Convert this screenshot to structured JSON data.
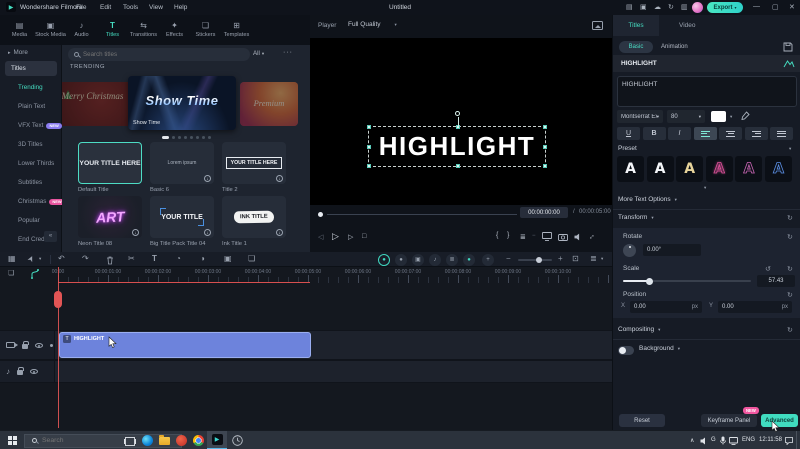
{
  "icons": {
    "chevron_down": "▾",
    "chevron_right": "▸",
    "collapse": "«",
    "more": "···",
    "media": "▤",
    "stock_media": "▣",
    "audio": "♪",
    "titles": "T",
    "transitions": "⇆",
    "effects": "✦",
    "stickers": "❏",
    "templates": "⊞",
    "layout": "▤",
    "gallery": "▣",
    "cloud": "☁",
    "sync": "↻",
    "store": "▥",
    "minimize": "—",
    "maximize": "▢",
    "close": "✕",
    "logo_play": "▶",
    "undo": "↶",
    "redo": "↷",
    "split": "✂",
    "text_tool": "T",
    "speed": "◔",
    "chroma": "◑",
    "crop": "▣",
    "group": "❏",
    "snap": "▦",
    "pointer": "➤",
    "prev_frame": "◁",
    "play": "▷",
    "next_frame": "▷",
    "stop": "□",
    "mark_in": "{",
    "mark_out": "}",
    "menu": "≣",
    "minus": "−",
    "expand": "↕",
    "reset": "↻",
    "reset_ccw": "↺",
    "zoom_out": "−",
    "zoom_in": "+",
    "fit": "⊡",
    "track_menu": "≣",
    "download": "↓",
    "music": "♪",
    "dot": "●",
    "win_chevron": "∧",
    "lang_g": "G"
  },
  "titlebar": {
    "app_name": "Wondershare Filmora",
    "menus": [
      "File",
      "Edit",
      "Tools",
      "View",
      "Help"
    ],
    "project_title": "Untitled",
    "export_label": "Export"
  },
  "panel_tabs": {
    "items": [
      {
        "label": "Media"
      },
      {
        "label": "Stock Media"
      },
      {
        "label": "Audio"
      },
      {
        "label": "Titles"
      },
      {
        "label": "Transitions"
      },
      {
        "label": "Effects"
      },
      {
        "label": "Stickers"
      },
      {
        "label": "Templates"
      }
    ]
  },
  "sidebar": {
    "more_label": "More",
    "group_label": "Titles",
    "items": [
      {
        "label": "Trending"
      },
      {
        "label": "Plain Text"
      },
      {
        "label": "VFX Text",
        "badge": "NEW"
      },
      {
        "label": "3D Titles"
      },
      {
        "label": "Lower Thirds"
      },
      {
        "label": "Subtitles"
      },
      {
        "label": "Christmas",
        "badge": "NEW"
      },
      {
        "label": "Popular"
      },
      {
        "label": "End Credits"
      }
    ]
  },
  "library": {
    "search_placeholder": "Search titles",
    "filter_label": "All",
    "section_title": "TRENDING",
    "carousel": {
      "left_title": "Merry Christmas",
      "center_title": "Show Time",
      "center_caption": "Show Time",
      "right_title": "Premium"
    },
    "templates": [
      {
        "preview": "YOUR TITLE HERE",
        "name": "Default Title"
      },
      {
        "preview": "Lorem ipsum",
        "name": "Basic 6"
      },
      {
        "preview": "YOUR TITLE HERE",
        "name": "Title 2"
      },
      {
        "preview": "ART",
        "name": "Neon Title 08"
      },
      {
        "preview": "YOUR TITLE",
        "name": "Big Title Pack Title 04"
      },
      {
        "preview": "INK TITLE",
        "name": "Ink Title 1"
      }
    ]
  },
  "player": {
    "label": "Player",
    "quality": "Full Quality",
    "current_time": "00:00:00:00",
    "separator": "/",
    "total_time": "00:00:05:00"
  },
  "preview": {
    "text": "HIGHLIGHT"
  },
  "inspector": {
    "tab_titles": "Titles",
    "tab_video": "Video",
    "subtab_basic": "Basic",
    "subtab_animation": "Animation",
    "clip_title": "HIGHLIGHT",
    "text_content": "HIGHLIGHT",
    "font_family": "Montserrat Extra",
    "font_size": "80",
    "format_glyphs": {
      "underline": "U",
      "bold": "B",
      "italic": "I"
    },
    "preset_label": "Preset",
    "preset_tiles": [
      {
        "letter": "A",
        "color": "#f4f6f9",
        "style": "solid"
      },
      {
        "letter": "A",
        "color": "#f4f6f9",
        "style": "solid"
      },
      {
        "letter": "A",
        "color": "#e7d49b",
        "style": "solid"
      },
      {
        "letter": "A",
        "color": "#e0529c",
        "style": "outline-glow"
      },
      {
        "letter": "A",
        "color": "#c966b4",
        "style": "outline"
      },
      {
        "letter": "A",
        "color": "#5b8fe4",
        "style": "outline"
      }
    ],
    "more_text_options": "More Text Options",
    "transform_label": "Transform",
    "rotate_label": "Rotate",
    "rotate_value": "0.00°",
    "scale_label": "Scale",
    "scale_value": "57.43",
    "position_label": "Position",
    "x_label": "X",
    "x_value": "0.00",
    "y_label": "Y",
    "y_value": "0.00",
    "unit": "px",
    "compositing_label": "Compositing",
    "background_label": "Background",
    "reset_label": "Reset",
    "keyframe_label": "Keyframe Panel",
    "keyframe_badge": "NEW",
    "advanced_label": "Advanced",
    "accent_color": "#45ddc1"
  },
  "timeline": {
    "ruler_labels": [
      "00:00",
      "00:00:01:00",
      "00:00:02:00",
      "00:00:03:00",
      "00:00:04:00",
      "00:00:05:00",
      "00:00:06:00",
      "00:00:07:00",
      "00:00:08:00",
      "00:00:09:00",
      "00:00:10:00"
    ],
    "clip_label": "HIGHLIGHT",
    "clip_color": "#6d83dc",
    "playhead_color": "#e25555"
  },
  "taskbar": {
    "search_placeholder": "Search",
    "language": "ENG",
    "time": "12:11:58"
  }
}
